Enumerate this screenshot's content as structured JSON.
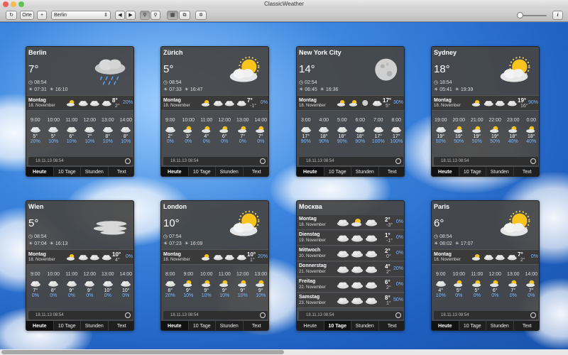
{
  "window": {
    "title": "ClassicWeather"
  },
  "toolbar": {
    "places_label": "Orte",
    "add_label": "+",
    "city_select": "Berlin",
    "prev": "◀",
    "next": "▶"
  },
  "tabs": [
    "Heute",
    "10 Tage",
    "Stunden",
    "Text"
  ],
  "cards": [
    {
      "city": "Berlin",
      "temp": "7°",
      "time": "08:54",
      "rise": "07:31",
      "set": "16:10",
      "day": "Montag",
      "date": "18. November",
      "hi": "8°",
      "lo": "2°",
      "pct": "20%",
      "hours": [
        [
          "9:00",
          "5°",
          "20%"
        ],
        [
          "10:00",
          "5°",
          "10%"
        ],
        [
          "11:00",
          "6°",
          "10%"
        ],
        [
          "12:00",
          "7°",
          "10%"
        ],
        [
          "13:00",
          "8°",
          "10%"
        ],
        [
          "14:00",
          "8°",
          "10%"
        ]
      ],
      "stamp": "18.11.13 08:54",
      "icon": "rain"
    },
    {
      "city": "Zürich",
      "temp": "5°",
      "time": "08:54",
      "rise": "07:33",
      "set": "16:47",
      "day": "Montag",
      "date": "18. November",
      "hi": "7°",
      "lo": "-1°",
      "pct": "0%",
      "hours": [
        [
          "9:00",
          "2°",
          "0%"
        ],
        [
          "10:00",
          "3°",
          "0%"
        ],
        [
          "11:00",
          "4°",
          "0%"
        ],
        [
          "12:00",
          "6°",
          "0%"
        ],
        [
          "13:00",
          "7°",
          "0%"
        ],
        [
          "14:00",
          "7°",
          "0%"
        ]
      ],
      "stamp": "18.11.13 08:54",
      "icon": "sun"
    },
    {
      "city": "New York City",
      "temp": "14°",
      "time": "02:54",
      "rise": "06:45",
      "set": "16:36",
      "day": "Montag",
      "date": "18. November",
      "hi": "17°",
      "lo": "5°",
      "pct": "30%",
      "hours": [
        [
          "3:00",
          "17°",
          "90%"
        ],
        [
          "4:00",
          "18°",
          "90%"
        ],
        [
          "5:00",
          "18°",
          "90%"
        ],
        [
          "6:00",
          "18°",
          "90%"
        ],
        [
          "7:00",
          "17°",
          "100%"
        ],
        [
          "8:00",
          "17°",
          "100%"
        ]
      ],
      "stamp": "18.11.13 08:54",
      "icon": "moon"
    },
    {
      "city": "Sydney",
      "temp": "18°",
      "time": "18:54",
      "rise": "05:41",
      "set": "19:39",
      "day": "Montag",
      "date": "18. November",
      "hi": "19°",
      "lo": "16°",
      "pct": "90%",
      "hours": [
        [
          "19:00",
          "19°",
          "50%"
        ],
        [
          "20:00",
          "19°",
          "50%"
        ],
        [
          "21:00",
          "19°",
          "50%"
        ],
        [
          "22:00",
          "19°",
          "50%"
        ],
        [
          "23:00",
          "18°",
          "40%"
        ],
        [
          "0:00",
          "18°",
          "40%"
        ]
      ],
      "stamp": "18.11.13 08:54",
      "icon": "sun"
    },
    {
      "city": "Wien",
      "temp": "5°",
      "time": "08:54",
      "rise": "07:04",
      "set": "16:13",
      "day": "Montag",
      "date": "18. November",
      "hi": "10°",
      "lo": "4°",
      "pct": "0%",
      "hours": [
        [
          "9:00",
          "7°",
          "0%"
        ],
        [
          "10:00",
          "8°",
          "0%"
        ],
        [
          "11:00",
          "9°",
          "0%"
        ],
        [
          "12:00",
          "9°",
          "0%"
        ],
        [
          "13:00",
          "10°",
          "0%"
        ],
        [
          "14:00",
          "10°",
          "0%"
        ]
      ],
      "stamp": "18.11.13 08:54",
      "icon": "fog"
    },
    {
      "city": "London",
      "temp": "10°",
      "time": "07:54",
      "rise": "07:23",
      "set": "16:09",
      "day": "Montag",
      "date": "18. November",
      "hi": "10°",
      "lo": "1°",
      "pct": "20%",
      "hours": [
        [
          "8:00",
          "8°",
          "20%"
        ],
        [
          "9:00",
          "9°",
          "10%"
        ],
        [
          "10:00",
          "9°",
          "10%"
        ],
        [
          "11:00",
          "9°",
          "10%"
        ],
        [
          "12:00",
          "9°",
          "10%"
        ],
        [
          "13:00",
          "9°",
          "10%"
        ]
      ],
      "stamp": "18.11.13 08:54",
      "icon": "sun"
    },
    {
      "city": "Paris",
      "temp": "6°",
      "time": "08:54",
      "rise": "08:02",
      "set": "17:07",
      "day": "Montag",
      "date": "18. November",
      "hi": "7°",
      "lo": "2°",
      "pct": "0%",
      "hours": [
        [
          "9:00",
          "4°",
          "10%"
        ],
        [
          "10:00",
          "5°",
          "0%"
        ],
        [
          "11:00",
          "5°",
          "0%"
        ],
        [
          "12:00",
          "6°",
          "0%"
        ],
        [
          "13:00",
          "7°",
          "0%"
        ],
        [
          "14:00",
          "7°",
          "0%"
        ]
      ],
      "stamp": "18.11.13 08:54",
      "icon": "sun"
    }
  ],
  "moskva": {
    "city": "Москва",
    "stamp": "18.11.13 08:54",
    "days": [
      [
        "Montag",
        "18. November",
        "2°",
        "-3°",
        "0%"
      ],
      [
        "Dienstag",
        "19. November",
        "1°",
        "-1°",
        "0%"
      ],
      [
        "Mittwoch",
        "20. November",
        "2°",
        "0°",
        "0%"
      ],
      [
        "Donnerstag",
        "21. November",
        "4°",
        "2°",
        "20%"
      ],
      [
        "Freitag",
        "22. November",
        "6°",
        "2°",
        "0%"
      ],
      [
        "Samstag",
        "23. November",
        "8°",
        "1°",
        "50%"
      ]
    ]
  }
}
